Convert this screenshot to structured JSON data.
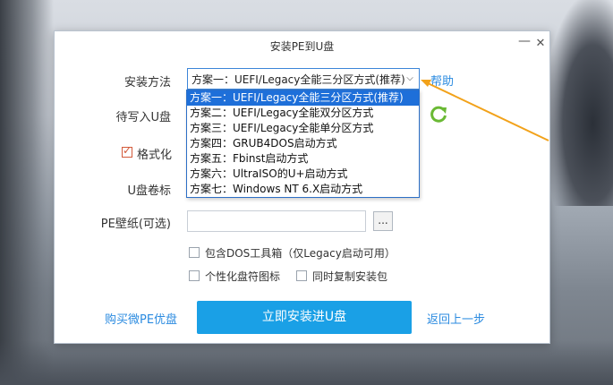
{
  "window": {
    "title": "安装PE到U盘",
    "minimize_label": "—",
    "close_label": "✕"
  },
  "form": {
    "install_method_label": "安装方法",
    "install_method_value": "方案一：UEFI/Legacy全能三分区方式(推荐)",
    "help_label": "帮助",
    "target_disk_label": "待写入U盘",
    "format_label": "格式化",
    "format_checked": true,
    "volume_label": "U盘卷标",
    "wallpaper_label": "PE壁纸(可选)",
    "wallpaper_value": "",
    "browse_label": "...",
    "include_dos_label": "包含DOS工具箱（仅Legacy启动可用）",
    "include_dos_checked": false,
    "custom_icon_label": "个性化盘符图标",
    "custom_icon_checked": false,
    "copy_installer_label": "同时复制安装包",
    "copy_installer_checked": false
  },
  "footer": {
    "buy_label": "购买微PE优盘",
    "install_label": "立即安装进U盘",
    "back_label": "返回上一步"
  },
  "dropdown": {
    "options": [
      "方案一：UEFI/Legacy全能三分区方式(推荐)",
      "方案二：UEFI/Legacy全能双分区方式",
      "方案三：UEFI/Legacy全能单分区方式",
      "方案四：GRUB4DOS启动方式",
      "方案五：Fbinst启动方式",
      "方案六：UltraISO的U+启动方式",
      "方案七：Windows NT 6.X启动方式"
    ],
    "selected_index": 0
  },
  "colors": {
    "accent": "#1aa0e6",
    "link": "#2b8be0",
    "selection": "#1e6fd9",
    "annotation_arrow": "#f2a21a"
  }
}
